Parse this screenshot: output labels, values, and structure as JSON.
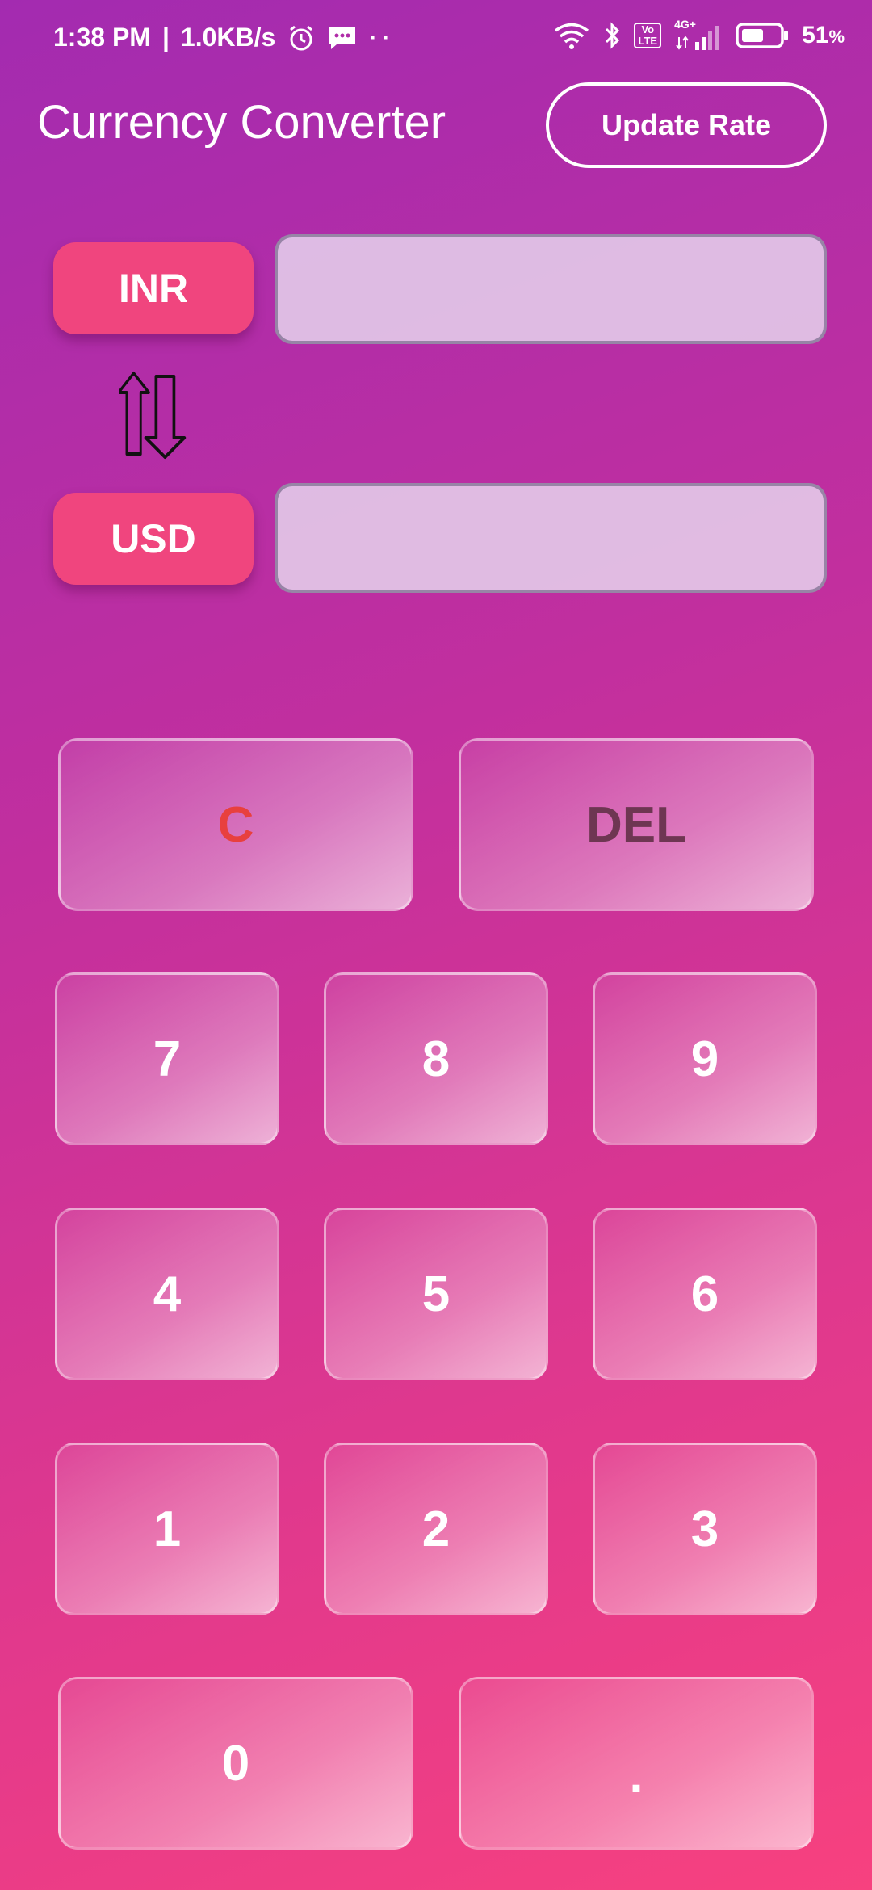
{
  "status_bar": {
    "time": "1:38 PM",
    "separator": "|",
    "speed": "1.0KB/s",
    "dots": "··",
    "battery": "51",
    "battery_unit": "%",
    "network_gen": "4G+",
    "volte_top": "Vo",
    "volte_bottom": "LTE"
  },
  "header": {
    "title": "Currency Converter",
    "update_button": "Update Rate"
  },
  "converter": {
    "from_currency": "INR",
    "to_currency": "USD",
    "from_value": "",
    "to_value": ""
  },
  "keypad": {
    "clear": "C",
    "delete": "DEL",
    "keys": [
      "7",
      "8",
      "9",
      "4",
      "5",
      "6",
      "1",
      "2",
      "3"
    ],
    "zero": "0",
    "decimal": "."
  },
  "colors": {
    "accent": "#f0457e",
    "clear_text": "#e8403e",
    "delete_text": "#6e3652"
  }
}
